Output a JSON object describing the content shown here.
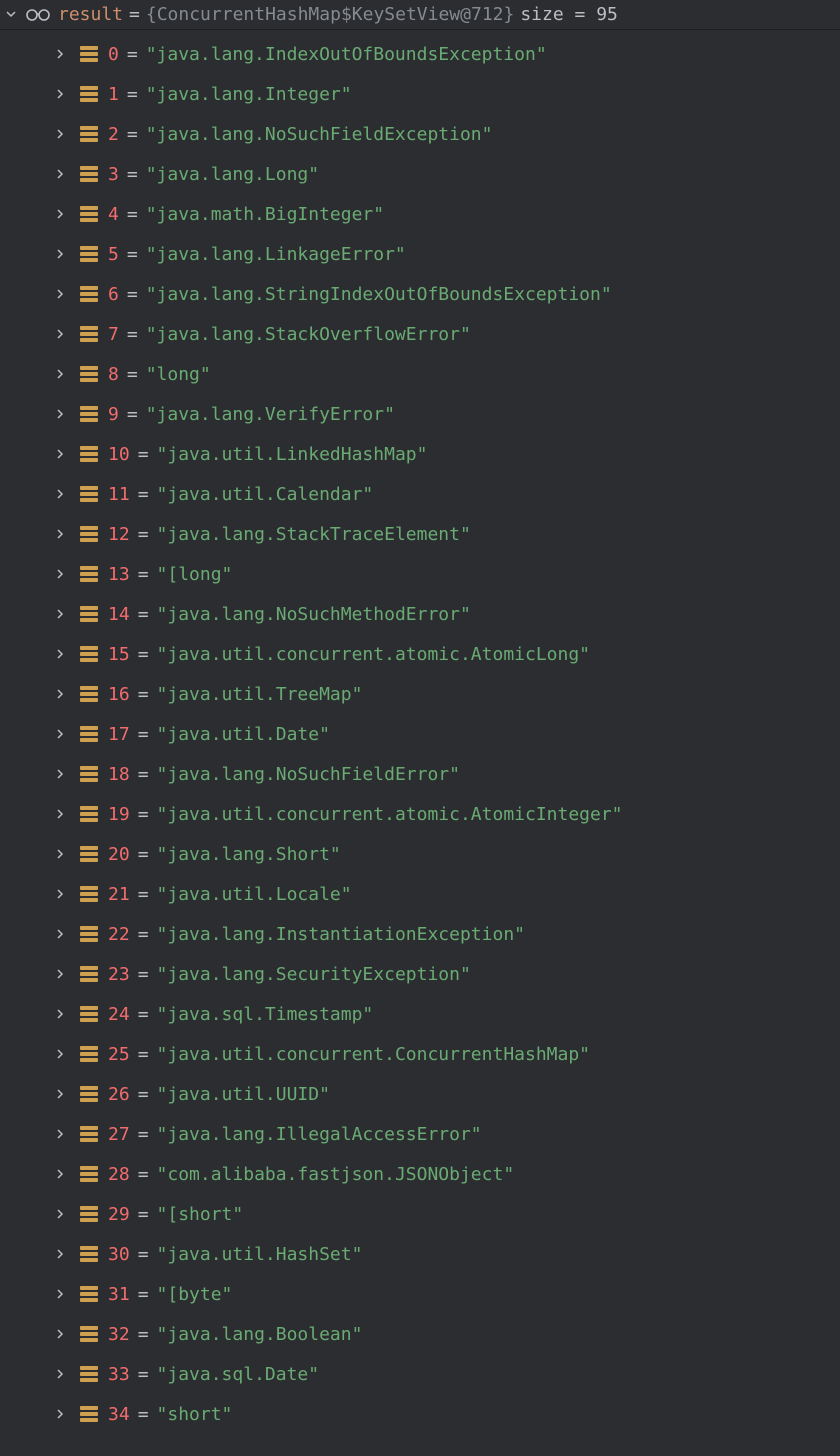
{
  "root": {
    "name": "result",
    "eq": "=",
    "type_ref": "{ConcurrentHashMap$KeySetView@712}",
    "size_label": "size = 95"
  },
  "entries": [
    {
      "idx": "0",
      "val": "\"java.lang.IndexOutOfBoundsException\""
    },
    {
      "idx": "1",
      "val": "\"java.lang.Integer\""
    },
    {
      "idx": "2",
      "val": "\"java.lang.NoSuchFieldException\""
    },
    {
      "idx": "3",
      "val": "\"java.lang.Long\""
    },
    {
      "idx": "4",
      "val": "\"java.math.BigInteger\""
    },
    {
      "idx": "5",
      "val": "\"java.lang.LinkageError\""
    },
    {
      "idx": "6",
      "val": "\"java.lang.StringIndexOutOfBoundsException\""
    },
    {
      "idx": "7",
      "val": "\"java.lang.StackOverflowError\""
    },
    {
      "idx": "8",
      "val": "\"long\""
    },
    {
      "idx": "9",
      "val": "\"java.lang.VerifyError\""
    },
    {
      "idx": "10",
      "val": "\"java.util.LinkedHashMap\""
    },
    {
      "idx": "11",
      "val": "\"java.util.Calendar\""
    },
    {
      "idx": "12",
      "val": "\"java.lang.StackTraceElement\""
    },
    {
      "idx": "13",
      "val": "\"[long\""
    },
    {
      "idx": "14",
      "val": "\"java.lang.NoSuchMethodError\""
    },
    {
      "idx": "15",
      "val": "\"java.util.concurrent.atomic.AtomicLong\""
    },
    {
      "idx": "16",
      "val": "\"java.util.TreeMap\""
    },
    {
      "idx": "17",
      "val": "\"java.util.Date\""
    },
    {
      "idx": "18",
      "val": "\"java.lang.NoSuchFieldError\""
    },
    {
      "idx": "19",
      "val": "\"java.util.concurrent.atomic.AtomicInteger\""
    },
    {
      "idx": "20",
      "val": "\"java.lang.Short\""
    },
    {
      "idx": "21",
      "val": "\"java.util.Locale\""
    },
    {
      "idx": "22",
      "val": "\"java.lang.InstantiationException\""
    },
    {
      "idx": "23",
      "val": "\"java.lang.SecurityException\""
    },
    {
      "idx": "24",
      "val": "\"java.sql.Timestamp\""
    },
    {
      "idx": "25",
      "val": "\"java.util.concurrent.ConcurrentHashMap\""
    },
    {
      "idx": "26",
      "val": "\"java.util.UUID\""
    },
    {
      "idx": "27",
      "val": "\"java.lang.IllegalAccessError\""
    },
    {
      "idx": "28",
      "val": "\"com.alibaba.fastjson.JSONObject\""
    },
    {
      "idx": "29",
      "val": "\"[short\""
    },
    {
      "idx": "30",
      "val": "\"java.util.HashSet\""
    },
    {
      "idx": "31",
      "val": "\"[byte\""
    },
    {
      "idx": "32",
      "val": "\"java.lang.Boolean\""
    },
    {
      "idx": "33",
      "val": "\"java.sql.Date\""
    },
    {
      "idx": "34",
      "val": "\"short\""
    }
  ]
}
